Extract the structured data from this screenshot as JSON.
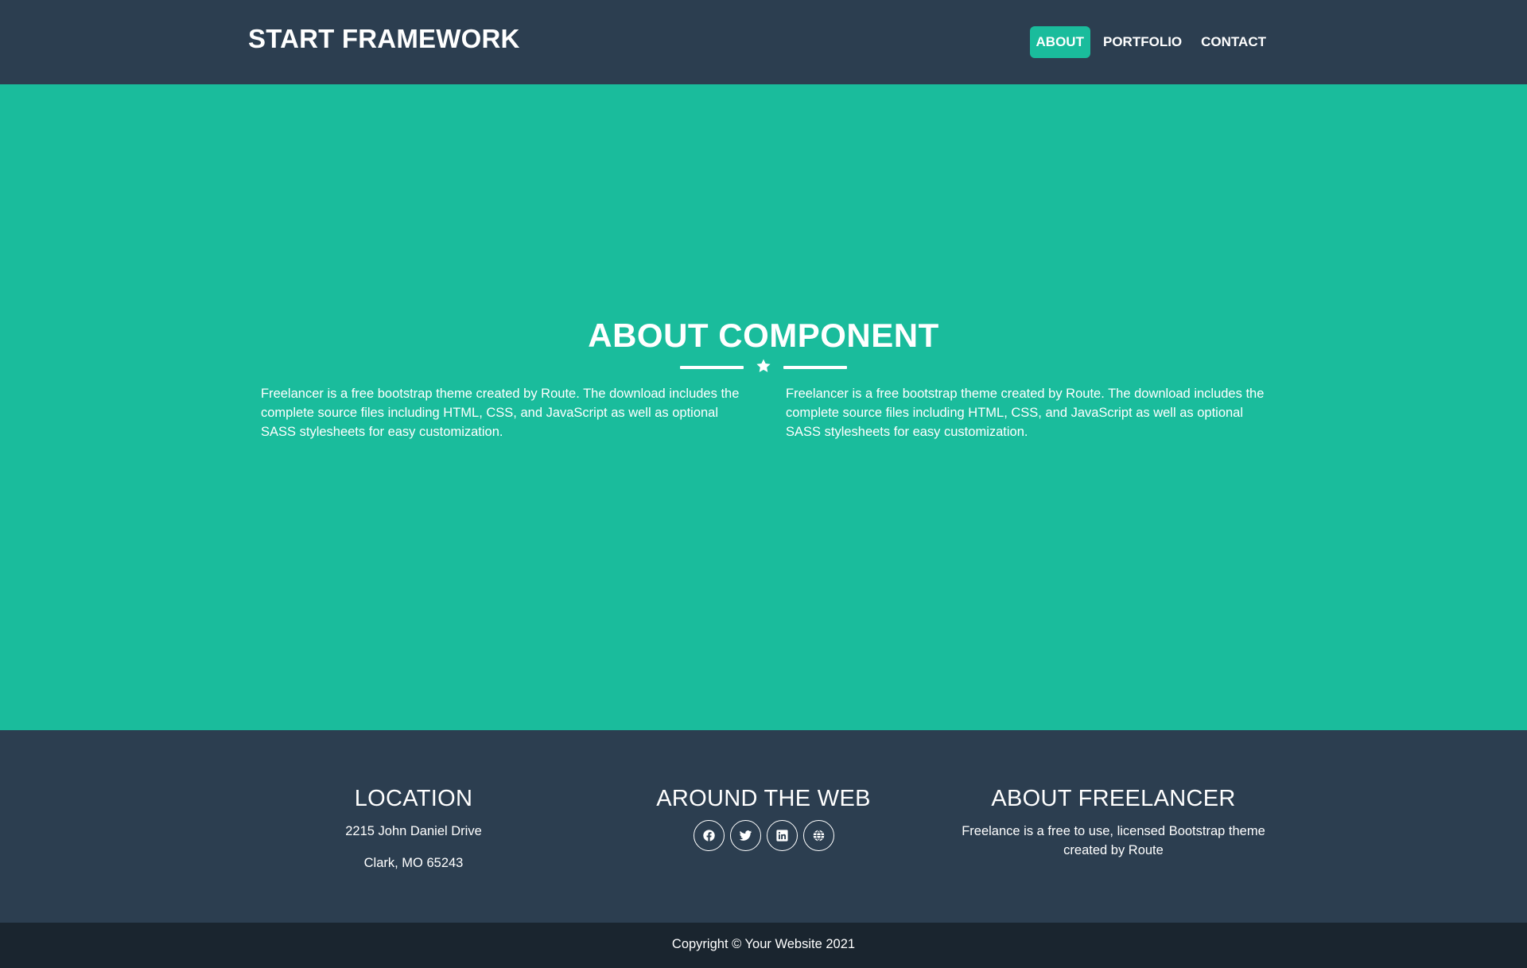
{
  "navbar": {
    "brand": "START FRAMEWORK",
    "links": [
      {
        "label": "ABOUT",
        "active": true
      },
      {
        "label": "PORTFOLIO",
        "active": false
      },
      {
        "label": "CONTACT",
        "active": false
      }
    ]
  },
  "about": {
    "title": "ABOUT COMPONENT",
    "divider_icon": "star-icon",
    "paragraphs": [
      "Freelancer is a free bootstrap theme created by Route. The download includes the complete source files including HTML, CSS, and JavaScript as well as optional SASS stylesheets for easy customization.",
      "Freelancer is a free bootstrap theme created by Route. The download includes the complete source files including HTML, CSS, and JavaScript as well as optional SASS stylesheets for easy customization."
    ]
  },
  "footer": {
    "location": {
      "heading": "LOCATION",
      "line1": "2215 John Daniel Drive",
      "line2": "Clark, MO 65243"
    },
    "web": {
      "heading": "AROUND THE WEB",
      "icons": [
        "facebook-icon",
        "twitter-icon",
        "linkedin-icon",
        "globe-icon"
      ]
    },
    "freelancer": {
      "heading": "ABOUT FREELANCER",
      "text": "Freelance is a free to use, licensed Bootstrap theme created by Route"
    }
  },
  "copyright": "Copyright © Your Website 2021",
  "colors": {
    "navbar": "#2c3e50",
    "accent": "#1abc9c",
    "footer": "#2c3e50",
    "copyright_bar": "#1a252f"
  }
}
